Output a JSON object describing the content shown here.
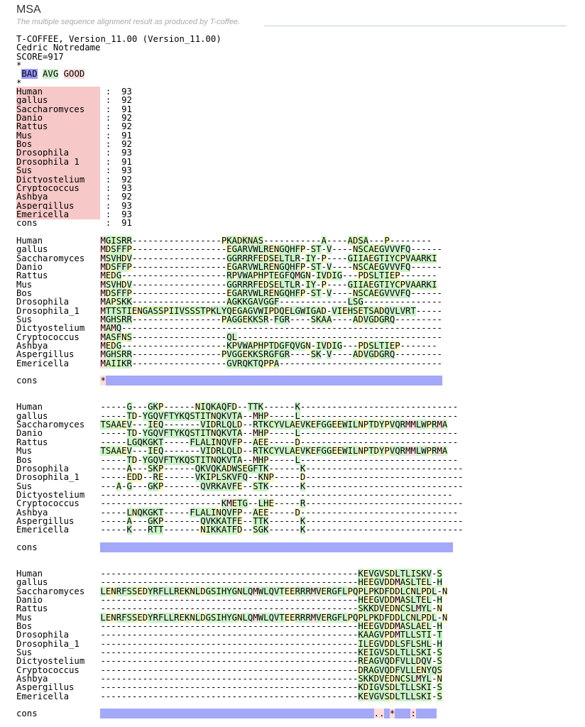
{
  "title": "MSA",
  "subtitle": "The multiple sequence alignment result as produced by T-coffee.",
  "header_lines": [
    "T-COFFEE, Version_11.00 (Version_11.00)",
    "Cedric Notredame",
    "SCORE=917",
    "*"
  ],
  "legend": {
    "bad": "BAD",
    "avg": "AVG",
    "good": "GOOD"
  },
  "legend_after": "*",
  "score_table": [
    {
      "name": "Human",
      "score": "93"
    },
    {
      "name": "gallus",
      "score": "92"
    },
    {
      "name": "Saccharomyces",
      "score": "91"
    },
    {
      "name": "Danio",
      "score": "92"
    },
    {
      "name": "Rattus",
      "score": "92"
    },
    {
      "name": "Mus",
      "score": "91"
    },
    {
      "name": "Bos",
      "score": "92"
    },
    {
      "name": "Drosophila",
      "score": "93"
    },
    {
      "name": "Drosophila_1",
      "score": "91"
    },
    {
      "name": "Sus",
      "score": "93"
    },
    {
      "name": "Dictyostelium",
      "score": "92"
    },
    {
      "name": "Cryptococcus",
      "score": "93"
    },
    {
      "name": "Ashbya",
      "score": "92"
    },
    {
      "name": "Aspergillus",
      "score": "93"
    },
    {
      "name": "Emericella",
      "score": "93"
    },
    {
      "name": "cons",
      "score": "91"
    }
  ],
  "blocks": [
    {
      "rows": [
        {
          "name": "Human",
          "seq": "MGISRR-----------------PKADKNAS-----------A----ADSA---P--------"
        },
        {
          "name": "gallus",
          "seq": "MDSFFP------------------EGARVWLRENGQHFP-ST-V----NSCAEGVVVFQ------"
        },
        {
          "name": "Saccharomyces",
          "seq": "MSVHDV------------------GGRRRFEDSELTLR-IY-P----GIIAEGTIYCPVAARKI"
        },
        {
          "name": "Danio",
          "seq": "MDSFFP------------------EGARVWLRENGQHFP-ST-V----NSCAEGVVVFQ------"
        },
        {
          "name": "Rattus",
          "seq": "MEDG--------------------RPVWAPHPTEGFQMGN-IVDIG---PDSLTIEP-------"
        },
        {
          "name": "Mus",
          "seq": "MSVHDV------------------GGRRRFEDSELTLR-IY-P----GIIAEGTIYCPVAARKI"
        },
        {
          "name": "Bos",
          "seq": "MDSFFP------------------EGARVWLRENGQHFP-ST-V----NSCAEGVVVFQ------"
        },
        {
          "name": "Drosophila",
          "seq": "MAPSKK------------------AGKKGAVGGF-------------LSG---------------"
        },
        {
          "name": "Drosophila_1",
          "seq": "MTTSTIENGASSPIIVSSSTPKLYQEGAGVWIPDQELGWIGAD-VIEHSETSADQVLVRT-----"
        },
        {
          "name": "Sus",
          "seq": "MGHSRR-----------------PAGGEKKSR-FGR----SKAA----ADVGDGRQ---------"
        },
        {
          "name": "Dictyostelium",
          "seq": "MAMQ-------------------------------------------------------------"
        },
        {
          "name": "Cryptococcus",
          "seq": "MASFNS------------------QL---------------------------------------"
        },
        {
          "name": "Ashbya",
          "seq": "MEDG--------------------KPVWAPHPTDGFQVGN-IVDIG---PDSLTIEP-------"
        },
        {
          "name": "Aspergillus",
          "seq": "MGHSRR-----------------PVGGEKKSRGFGR----SK-V----ADVGDGRQ---------"
        },
        {
          "name": "Emericella",
          "seq": "MAIIKR------------------GVRQKTQPPA-------------------------------"
        }
      ],
      "cons": "*                                                                "
    },
    {
      "rows": [
        {
          "name": "Human",
          "seq": "-----G---GKP------NIQKAQFD--TTK------K------------------------------"
        },
        {
          "name": "gallus",
          "seq": "-----TD-YGQVFTYKQSTITNQKVTA--MHP-----L------------------------------"
        },
        {
          "name": "Saccharomyces",
          "seq": "TSAAEV---IEQ-------VIDRLQLD--RTKCYVLAEVKEFGGEEWILNPTDYPVQRMMLWPRMA"
        },
        {
          "name": "Danio",
          "seq": "-----TD-YGQVFTYKQSTITNQKVTA--MHP-----L------------------------------"
        },
        {
          "name": "Rattus",
          "seq": "-----LGQKGKT-----FLALINQVFP--AEE-----D------------------------------"
        },
        {
          "name": "Mus",
          "seq": "TSAAEV---IEQ-------VIDRLQLD--RTKCYVLAEVKEFGGEEWILNPTDYPVQRMMLWPRMA"
        },
        {
          "name": "Bos",
          "seq": "-----TD-YGQVFTYKQSTITNQKVTA--MHP-----L------------------------------"
        },
        {
          "name": "Drosophila",
          "seq": "-----A---SKP------QKVQKADWSEGFTK------K------------------------------"
        },
        {
          "name": "Drosophila_1",
          "seq": "-----EDD--RE------VKIPLSKVFQ--KNP-----D------------------------------"
        },
        {
          "name": "Sus",
          "seq": "---A-G---GKP-------QVRKAVFE--STK------K------------------------------"
        },
        {
          "name": "Dictyostelium",
          "seq": "-------------------------------------------------------------------"
        },
        {
          "name": "Cryptococcus",
          "seq": "-----------------------KMETG--LHE-----R------------------------------"
        },
        {
          "name": "Ashbya",
          "seq": "-----LNQKGKT-----FLALINQVFP--AEE-----D------------------------------"
        },
        {
          "name": "Aspergillus",
          "seq": "-----A---GKP-------QVKKATFE--TTK------K------------------------------"
        },
        {
          "name": "Emericella",
          "seq": "-----K---RTT-------NIKKATFD--SGK------K------------------------------"
        }
      ],
      "cons": "                                                                   "
    },
    {
      "rows": [
        {
          "name": "Human",
          "seq": "-------------------------------------------------KEVGVSDLTLISKV-S"
        },
        {
          "name": "gallus",
          "seq": "-------------------------------------------------HEEGVDDMASLTEL-H"
        },
        {
          "name": "Saccharomyces",
          "seq": "LENRFSSEDYRFLLREKNLDGSIHYGNLQMWLQVTEERRRMVERGFLPQPLPKDFDDLCNLPDL-N"
        },
        {
          "name": "Danio",
          "seq": "-------------------------------------------------HEEGVDDMASLTEL-H"
        },
        {
          "name": "Rattus",
          "seq": "-------------------------------------------------SKKDVEDNCSLMYL-N"
        },
        {
          "name": "Mus",
          "seq": "LENRFSSEDYRFLLREKNLDGSIHYGNLQMWLQVTEERRRMVERGFLPQPLPKDFDDLCNLPDL-N"
        },
        {
          "name": "Bos",
          "seq": "-------------------------------------------------HEEGVDDMASLAEL-H"
        },
        {
          "name": "Drosophila",
          "seq": "-------------------------------------------------KAAGVPDMTLLSTI-T"
        },
        {
          "name": "Drosophila_1",
          "seq": "-------------------------------------------------ILEGVDDLSFLSHL-H"
        },
        {
          "name": "Sus",
          "seq": "-------------------------------------------------KEIGVSDLTLLSKI-S"
        },
        {
          "name": "Dictyostelium",
          "seq": "-------------------------------------------------REAGVQDFVLLDQV-S"
        },
        {
          "name": "Cryptococcus",
          "seq": "-------------------------------------------------DRAGVQDFVLLENYQS"
        },
        {
          "name": "Ashbya",
          "seq": "-------------------------------------------------SKKDVEDNCSLMYL-N"
        },
        {
          "name": "Aspergillus",
          "seq": "-------------------------------------------------KDIGVSDLTLLSKI-S"
        },
        {
          "name": "Emericella",
          "seq": "-------------------------------------------------KEVGVSDLTLLSKI-S"
        }
      ],
      "cons": "                                                    .. *   :    "
    }
  ],
  "cons_label": "cons",
  "colors": {
    "bad": "#9999ff",
    "avg": "#ccf0cc",
    "good": "#ffdddd",
    "name_bg": "#f7c8c8"
  }
}
